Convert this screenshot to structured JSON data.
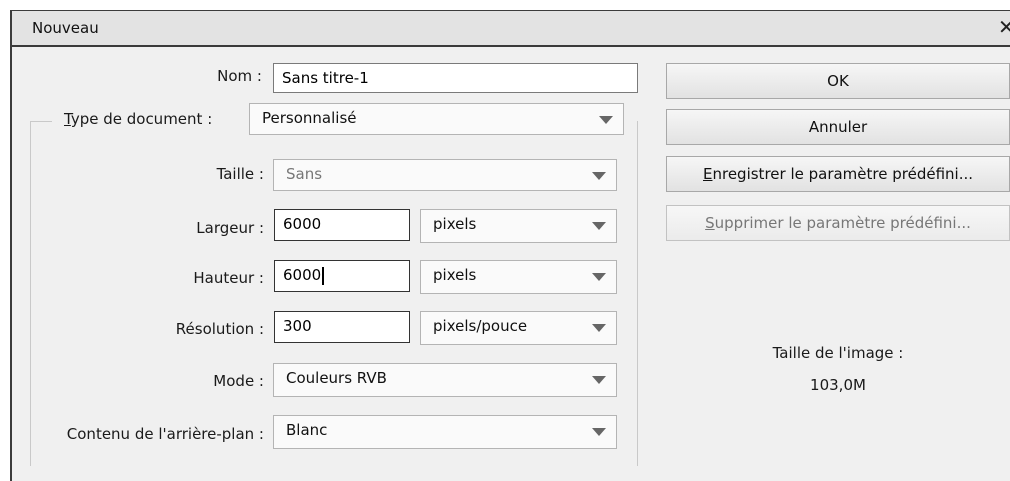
{
  "window": {
    "title": "Nouveau",
    "close_glyph": "✕"
  },
  "form": {
    "name": {
      "label": "Nom :",
      "value": "Sans titre-1"
    },
    "doc_type": {
      "label_prefix": "T",
      "label_rest": "ype de document :",
      "value": "Personnalisé"
    },
    "size": {
      "label": "Taille :",
      "value": "Sans"
    },
    "width": {
      "label": "Largeur :",
      "value": "6000",
      "unit": "pixels"
    },
    "height": {
      "label": "Hauteur :",
      "value": "6000",
      "unit": "pixels"
    },
    "resolution": {
      "label": "Résolution :",
      "value": "300",
      "unit": "pixels/pouce"
    },
    "mode": {
      "label": "Mode :",
      "value": "Couleurs RVB"
    },
    "background": {
      "label": "Contenu de l'arrière-plan :",
      "value": "Blanc"
    }
  },
  "buttons": {
    "ok": "OK",
    "cancel": "Annuler",
    "save_preset_prefix": "E",
    "save_preset_rest": "nregistrer le paramètre prédéfini...",
    "delete_preset_prefix": "S",
    "delete_preset_rest": "upprimer le paramètre prédéfini..."
  },
  "image_size": {
    "label": "Taille de l'image :",
    "value": "103,0M"
  }
}
